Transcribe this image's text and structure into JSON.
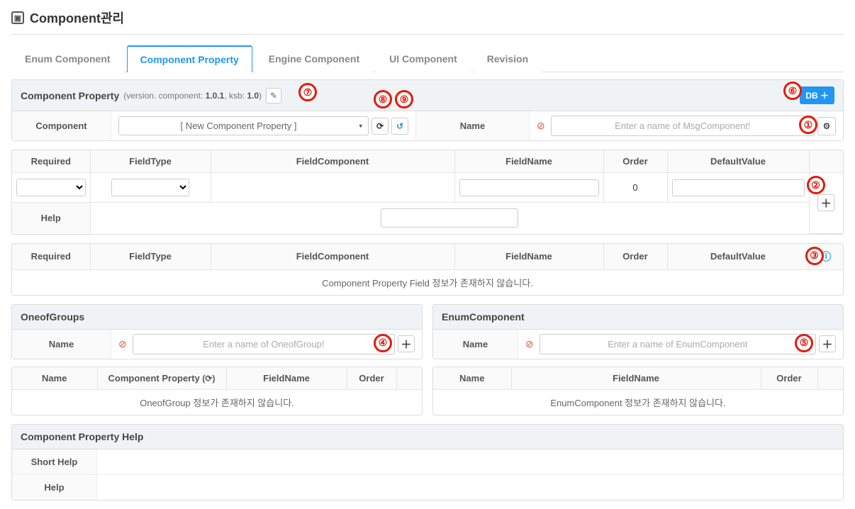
{
  "page": {
    "title": "Component관리"
  },
  "tabs": {
    "items": [
      "Enum Component",
      "Component Property",
      "Engine Component",
      "UI Component",
      "Revision"
    ],
    "activeIndex": 1
  },
  "componentProperty": {
    "title": "Component Property",
    "versionLabel": "(version. component: ",
    "versionComp": "1.0.1",
    "versionSep": ", ksb: ",
    "versionKsb": "1.0",
    "versionEnd": ")",
    "dbBtn": "DB ＋",
    "componentLabel": "Component",
    "componentDropdown": "[ New Component Property ]",
    "nameLabel": "Name",
    "namePlaceholder": "Enter a name of MsgComponent!"
  },
  "fieldEditor": {
    "headers": [
      "Required",
      "FieldType",
      "FieldComponent",
      "FieldName",
      "Order",
      "DefaultValue"
    ],
    "orderValue": "0",
    "helpLabel": "Help"
  },
  "fieldList": {
    "headers": [
      "Required",
      "FieldType",
      "FieldComponent",
      "FieldName",
      "Order",
      "DefaultValue"
    ],
    "emptyMsg": "Component Property Field 정보가 존재하지 않습니다."
  },
  "oneofGroups": {
    "title": "OneofGroups",
    "nameLabel": "Name",
    "namePlaceholder": "Enter a name of OneofGroup!",
    "tableHeaders": {
      "name": "Name",
      "compProp": "Component Property ",
      "fieldName": "FieldName",
      "order": "Order"
    },
    "emptyMsg": "OneofGroup 정보가 존재하지 않습니다."
  },
  "enumComponent": {
    "title": "EnumComponent",
    "nameLabel": "Name",
    "namePlaceholder": "Enter a name of EnumComponent",
    "tableHeaders": {
      "name": "Name",
      "fieldName": "FieldName",
      "order": "Order"
    },
    "emptyMsg": "EnumComponent 정보가 존재하지 않습니다."
  },
  "helpSection": {
    "title": "Component Property Help",
    "shortHelpLabel": "Short Help",
    "helpLabel": "Help"
  },
  "markers": {
    "m1": "①",
    "m2": "②",
    "m3": "③",
    "m4": "④",
    "m5": "⑤",
    "m6": "⑥",
    "m7": "⑦",
    "m8": "⑧",
    "m9": "⑨"
  }
}
